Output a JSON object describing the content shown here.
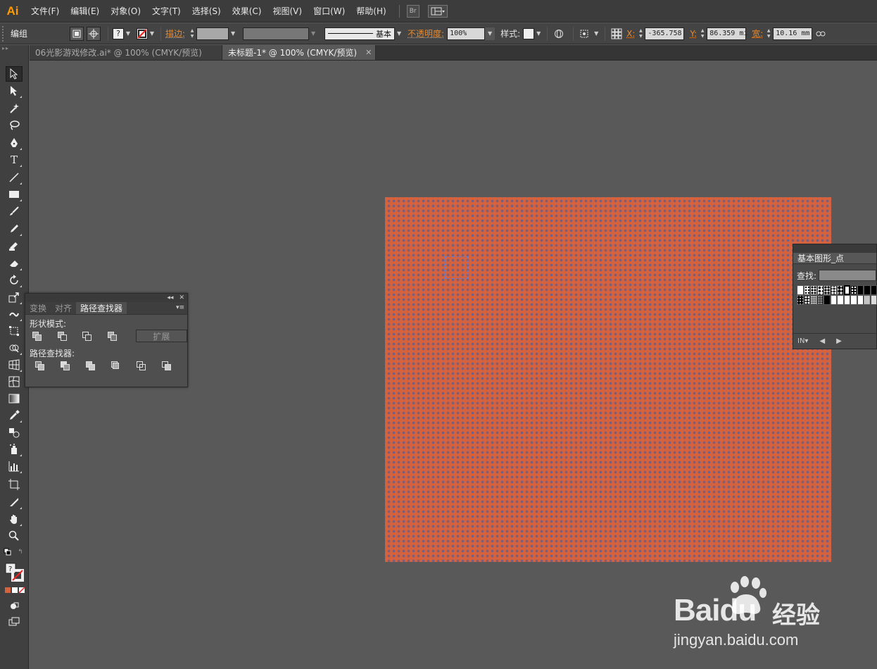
{
  "app": {
    "logo": "Ai"
  },
  "menu": {
    "items": [
      "文件(F)",
      "编辑(E)",
      "对象(O)",
      "文字(T)",
      "选择(S)",
      "效果(C)",
      "视图(V)",
      "窗口(W)",
      "帮助(H)"
    ],
    "bridge_label": "Br"
  },
  "control": {
    "selection_label": "编组",
    "stroke_label": "描边:",
    "stroke_profile": "基本",
    "opacity_label": "不透明度:",
    "opacity_value": "100%",
    "style_label": "样式:",
    "x_label": "X:",
    "x_value": "-365.758",
    "y_label": "Y:",
    "y_value": "86.359 mi",
    "w_label": "宽:",
    "w_value": "10.16 mm"
  },
  "tabs": [
    {
      "label": "06光影游戏修改.ai* @ 100% (CMYK/预览)"
    },
    {
      "label": "未标题-1* @ 100% (CMYK/预览)",
      "close": "✕"
    }
  ],
  "pathfinder": {
    "tabs": [
      "变换",
      "对齐",
      "路径查找器"
    ],
    "shape_modes_label": "形状模式:",
    "expand_label": "扩展",
    "pathfinders_label": "路径查找器:"
  },
  "swatches": {
    "title": "基本图形_点",
    "find_label": "查找:"
  },
  "watermark": {
    "url": "jingyan.baidu.com"
  },
  "colors": {
    "artboard": "#d4623e",
    "dots": "#7b5f7a",
    "selection": "#6a78c9",
    "accent": "#ff9a00"
  },
  "toolbar": {
    "tools": [
      "selection-tool-icon",
      "direct-selection-tool-icon",
      "magic-wand-icon",
      "lasso-icon",
      "pen-tool-icon",
      "type-tool-icon",
      "line-tool-icon",
      "rectangle-tool-icon",
      "paintbrush-icon",
      "pencil-icon",
      "blob-brush-icon",
      "eraser-icon",
      "rotate-tool-icon",
      "scale-tool-icon",
      "warp-tool-icon",
      "free-transform-icon",
      "shape-builder-icon",
      "perspective-grid-icon",
      "mesh-tool-icon",
      "gradient-tool-icon",
      "eyedropper-icon",
      "blend-tool-icon",
      "symbol-sprayer-icon",
      "graph-tool-icon",
      "artboard-tool-icon",
      "slice-tool-icon",
      "hand-tool-icon",
      "zoom-tool-icon"
    ]
  }
}
